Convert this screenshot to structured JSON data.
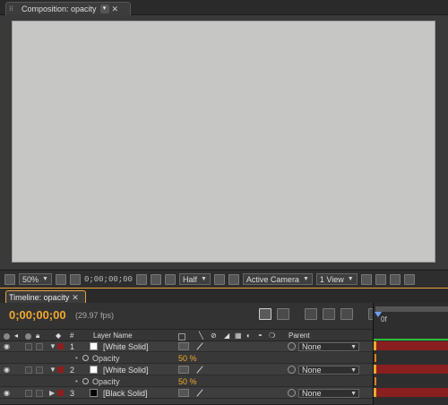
{
  "composition": {
    "tab_title": "Composition: opacity",
    "toolbar": {
      "zoom": "50%",
      "timecode": "0;00;00;00",
      "resolution": "Half",
      "camera": "Active Camera",
      "views": "1 View"
    }
  },
  "timeline": {
    "tab_title": "Timeline: opacity",
    "timecode": "0;00;00;00",
    "fps": "(29.97 fps)",
    "ruler_label": "0f",
    "columns": {
      "hash": "#",
      "layer_name": "Layer Name",
      "parent": "Parent"
    },
    "layers": [
      {
        "num": "1",
        "name": "[White Solid]",
        "parent": "None",
        "solid_color": "#ffffff",
        "expanded": true,
        "property": {
          "name": "Opacity",
          "value": "50 %"
        }
      },
      {
        "num": "2",
        "name": "[White Solid]",
        "parent": "None",
        "solid_color": "#ffffff",
        "expanded": true,
        "property": {
          "name": "Opacity",
          "value": "50 %"
        }
      },
      {
        "num": "3",
        "name": "[Black Solid]",
        "parent": "None",
        "solid_color": "#000000",
        "expanded": false
      }
    ]
  },
  "colors": {
    "accent": "#f0a830",
    "label_red": "#8c1e1e",
    "canvas": "#c6c6c4",
    "work_area": "#2fbf3f"
  }
}
